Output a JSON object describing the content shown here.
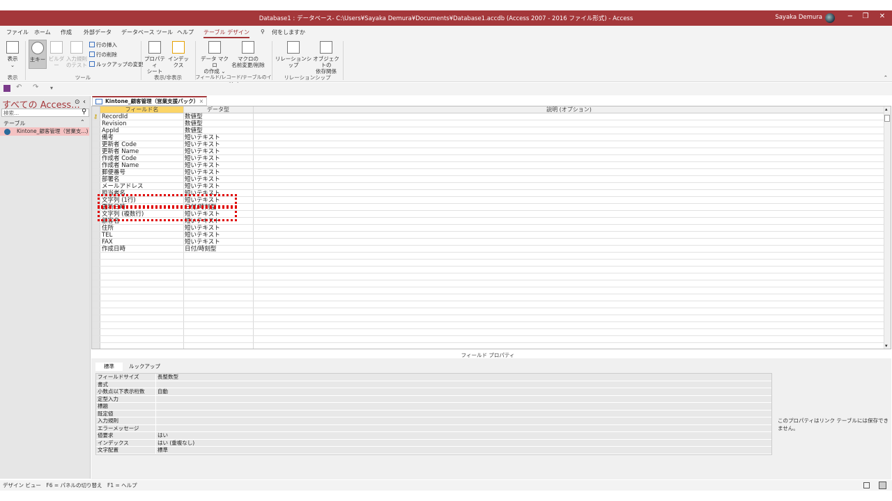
{
  "window": {
    "title": "Database1 : データベース- C:\\Users¥Sayaka Demura¥Documents¥Database1.accdb (Access 2007 - 2016 ファイル形式) - Access",
    "user": "Sayaka Demura",
    "minimize": "−",
    "restore": "❐",
    "close": "✕"
  },
  "menu": {
    "tabs": [
      "ファイル",
      "ホーム",
      "作成",
      "外部データ",
      "データベース ツール",
      "ヘルプ",
      "テーブル デザイン"
    ],
    "search": "何をしますか"
  },
  "ribbon": {
    "view": {
      "label": "表示",
      "arrow": "⌄",
      "group": "表示"
    },
    "tools": {
      "primary_key": "主キー",
      "builder": "ビルダー",
      "test_rules": "入力規則\nのテスト",
      "insert_row": "行の挿入",
      "delete_row": "行の削除",
      "modify_lookups": "ルックアップの変更",
      "group": "ツール"
    },
    "showhide": {
      "property_sheet": "プロパティ\nシート",
      "indexes": "インデックス",
      "group": "表示/非表示"
    },
    "events": {
      "create_macros": "データ マクロ\nの作成 ⌄",
      "rename_macro": "マクロの\n名前変更/削除",
      "group": "フィールド/レコード/テーブルのイベント"
    },
    "relationships": {
      "relationships": "リレーションシップ",
      "dependencies": "オブジェクトの\n依存関係",
      "group": "リレーションシップ"
    }
  },
  "nav": {
    "title": "すべての Access...",
    "search_placeholder": "検索...",
    "group": "テーブル",
    "items": [
      "Kintone_顧客管理（営業支...)"
    ]
  },
  "document": {
    "tab": "Kintone_顧客管理（営業支援パック）",
    "close": "×"
  },
  "grid": {
    "headers": {
      "field_name": "フィールド名",
      "data_type": "データ型",
      "description": "説明 (オプション)"
    },
    "rows": [
      {
        "name": "RecordId",
        "type": "数値型"
      },
      {
        "name": "Revision",
        "type": "数値型"
      },
      {
        "name": "AppId",
        "type": "数値型"
      },
      {
        "name": "備考",
        "type": "短いテキスト"
      },
      {
        "name": "更新者 Code",
        "type": "短いテキスト"
      },
      {
        "name": "更新者 Name",
        "type": "短いテキスト"
      },
      {
        "name": "作成者 Code",
        "type": "短いテキスト"
      },
      {
        "name": "作成者 Name",
        "type": "短いテキスト"
      },
      {
        "name": "郵便番号",
        "type": "短いテキスト"
      },
      {
        "name": "部署名",
        "type": "短いテキスト"
      },
      {
        "name": "メールアドレス",
        "type": "短いテキスト"
      },
      {
        "name": "担当者名",
        "type": "短いテキスト"
      },
      {
        "name": "文字列 (1行)",
        "type": "短いテキスト"
      },
      {
        "name": "更新日時",
        "type": "日付/時刻型"
      },
      {
        "name": "文字列 (複数行)",
        "type": "短いテキスト"
      },
      {
        "name": "顧客名",
        "type": "短いテキスト"
      },
      {
        "name": "住所",
        "type": "短いテキスト"
      },
      {
        "name": "TEL",
        "type": "短いテキスト"
      },
      {
        "name": "FAX",
        "type": "短いテキスト"
      },
      {
        "name": "作成日時",
        "type": "日付/時刻型"
      }
    ]
  },
  "properties": {
    "title": "フィールド プロパティ",
    "tabs": [
      "標準",
      "ルックアップ"
    ],
    "rows": [
      {
        "label": "フィールドサイズ",
        "value": "長整数型"
      },
      {
        "label": "書式",
        "value": ""
      },
      {
        "label": "小数点以下表示桁数",
        "value": "自動"
      },
      {
        "label": "定型入力",
        "value": ""
      },
      {
        "label": "標題",
        "value": ""
      },
      {
        "label": "既定値",
        "value": ""
      },
      {
        "label": "入力規則",
        "value": ""
      },
      {
        "label": "エラーメッセージ",
        "value": ""
      },
      {
        "label": "値要求",
        "value": "はい"
      },
      {
        "label": "インデックス",
        "value": "はい (重複なし)"
      },
      {
        "label": "文字配置",
        "value": "標準"
      }
    ],
    "note": "このプロパティはリンク テーブルには保存できません。"
  },
  "status": {
    "text": "デザイン ビュー　F6 = パネルの切り替え　F1 = ヘルプ"
  }
}
